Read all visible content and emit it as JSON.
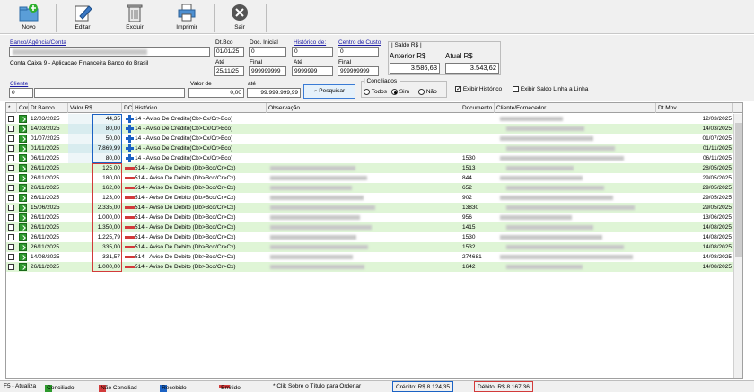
{
  "toolbar": {
    "novo": "Novo",
    "editar": "Editar",
    "excluir": "Excluir",
    "imprimir": "Imprimir",
    "sair": "Sair"
  },
  "filters": {
    "banco_label": "Banco/Agência/Conta",
    "conta_desc": "Conta Caixa   9 - Aplicacao Financeira Banco do Brasil",
    "dt_bco_label": "Dt.Bco",
    "dt_bco_from": "01/01/25",
    "ate_label": "Até",
    "dt_bco_to": "25/11/25",
    "doc_inicial_label": "Doc. Inicial",
    "doc_inicial": "0",
    "final_label": "Final",
    "doc_final": "999999999",
    "historico_label": "Histórico de:",
    "historico_de": "0",
    "historico_ate_label": "Até",
    "historico_ate": "9999999",
    "centro_label": "Centro de Custo",
    "centro_de": "0",
    "centro_final_label": "Final",
    "centro_ate": "999999999",
    "saldo_title": "| Saldo R$ |",
    "anterior_label": "Anterior R$",
    "anterior_value": "3.586,63",
    "atual_label": "Atual R$",
    "atual_value": "3.543,62",
    "cliente_label": "Cliente",
    "cliente_value": "0",
    "valor_de_label": "Valor de",
    "valor_de": "0,00",
    "valor_ate_label": "até",
    "valor_ate": "99.999.999,99",
    "pesquisar": "Pesquisar",
    "conciliados_title": "| Conciliados |",
    "opt_todos": "Todos",
    "opt_sim": "Sim",
    "opt_nao": "Não",
    "exibir_historico": "Exibir Histórico",
    "exibir_saldo": "Exibir Saldo Linha a Linha"
  },
  "grid": {
    "headers": [
      "*",
      "Con",
      "Dt.Banco",
      "Valor R$",
      "DC",
      "Histórico",
      "Observação",
      "Documento",
      "Cliente/Fornecedor",
      "Dt.Mov"
    ],
    "rows": [
      {
        "dt": "12/03/2025",
        "valor": "44,35",
        "type": "C",
        "hist": "14 - Aviso De Credito(Cb>Cx/Cr>Bco)",
        "doc": "",
        "mov": "12/03/2025"
      },
      {
        "dt": "14/03/2025",
        "valor": "80,00",
        "type": "C",
        "hist": "14 - Aviso De Credito(Cb>Cx/Cr>Bco)",
        "doc": "",
        "mov": "14/03/2025"
      },
      {
        "dt": "01/07/2025",
        "valor": "50,00",
        "type": "C",
        "hist": "14 - Aviso De Credito(Cb>Cx/Cr>Bco)",
        "doc": "",
        "mov": "01/07/2025"
      },
      {
        "dt": "01/11/2025",
        "valor": "7.869,99",
        "type": "C",
        "hist": "14 - Aviso De Credito(Cb>Cx/Cr>Bco)",
        "doc": "",
        "mov": "01/11/2025"
      },
      {
        "dt": "06/11/2025",
        "valor": "80,00",
        "type": "C",
        "hist": "14 - Aviso De Credito(Cb>Cx/Cr>Bco)",
        "doc": "1530",
        "mov": "06/11/2025"
      },
      {
        "dt": "26/11/2025",
        "valor": "125,00",
        "type": "D",
        "hist": "514 - Aviso De Debito (Db>Bco/Cr>Cx)",
        "doc": "1513",
        "mov": "28/05/2025"
      },
      {
        "dt": "26/11/2025",
        "valor": "180,00",
        "type": "D",
        "hist": "514 - Aviso De Debito (Db>Bco/Cr>Cx)",
        "doc": "844",
        "mov": "29/05/2025"
      },
      {
        "dt": "26/11/2025",
        "valor": "162,00",
        "type": "D",
        "hist": "514 - Aviso De Debito (Db>Bco/Cr>Cx)",
        "doc": "652",
        "mov": "29/05/2025"
      },
      {
        "dt": "26/11/2025",
        "valor": "123,00",
        "type": "D",
        "hist": "514 - Aviso De Debito (Db>Bco/Cr>Cx)",
        "doc": "902",
        "mov": "29/05/2025"
      },
      {
        "dt": "15/06/2025",
        "valor": "2.335,00",
        "type": "D",
        "hist": "514 - Aviso De Debito (Db>Bco/Cr>Cx)",
        "doc": "13830",
        "mov": "29/05/2025"
      },
      {
        "dt": "26/11/2025",
        "valor": "1.000,00",
        "type": "D",
        "hist": "514 - Aviso De Debito (Db>Bco/Cr>Cx)",
        "doc": "956",
        "mov": "13/06/2025"
      },
      {
        "dt": "26/11/2025",
        "valor": "1.350,00",
        "type": "D",
        "hist": "514 - Aviso De Debito (Db>Bco/Cr>Cx)",
        "doc": "1415",
        "mov": "14/08/2025"
      },
      {
        "dt": "26/11/2025",
        "valor": "1.225,79",
        "type": "D",
        "hist": "514 - Aviso De Debito (Db>Bco/Cr>Cx)",
        "doc": "1530",
        "mov": "14/08/2025"
      },
      {
        "dt": "26/11/2025",
        "valor": "335,00",
        "type": "D",
        "hist": "514 - Aviso De Debito (Db>Bco/Cr>Cx)",
        "doc": "1532",
        "mov": "14/08/2025"
      },
      {
        "dt": "14/08/2025",
        "valor": "331,57",
        "type": "D",
        "hist": "514 - Aviso De Debito (Db>Bco/Cr>Cx)",
        "doc": "274681",
        "mov": "14/08/2025"
      },
      {
        "dt": "26/11/2025",
        "valor": "1.000,00",
        "type": "D",
        "hist": "514 - Aviso De Debito (Db>Bco/Cr>Cx)",
        "doc": "1642",
        "mov": "14/08/2025"
      }
    ]
  },
  "status": {
    "f5": "F5 - Atualiza",
    "conciliado": "-Conciliado",
    "nao_conciliado": "-Não Conciliad",
    "recebido": "-Recebido",
    "emitido": "-Emitido",
    "hint": "* Clik Sobre o Título para Ordenar",
    "credito": "Crédito: R$ 8.124,35",
    "debito": "Débito: R$ 8.167,36"
  },
  "colors": {
    "credit": "#1b62c4",
    "debit": "#d23a3a",
    "conciliado": "#2d9a2d",
    "row_alt": "#dff5d6"
  }
}
